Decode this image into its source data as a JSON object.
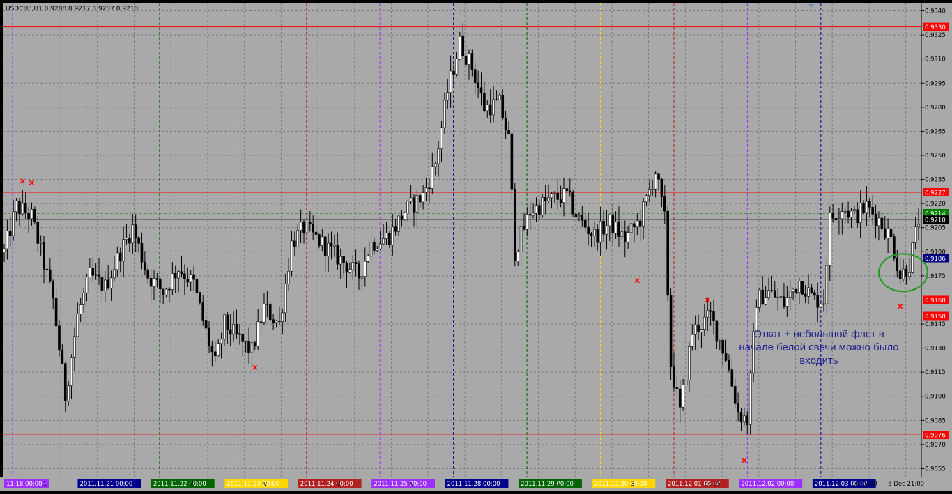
{
  "window_title": "USDCHF,H1  0.9208 0.9217 0.9207 0.9210",
  "annotation_text": "Откат + небольшой флет в начале белой свечи можно было входить",
  "colors": {
    "background": "#a9a9a9",
    "grid": "#7a7a7a",
    "candle": "#000000",
    "support_resistance": "#ff0000",
    "circle": "#1c9b1c",
    "current_price": "#000080"
  },
  "chart_data": {
    "type": "candlestick",
    "symbol": "USDCHF",
    "timeframe": "H1",
    "ylim": [
      0.905,
      0.9345
    ],
    "price_ticks": [
      "0.9340",
      "0.9325",
      "0.9310",
      "0.9295",
      "0.9280",
      "0.9265",
      "0.9250",
      "0.9235",
      "0.9220",
      "0.9205",
      "0.9190",
      "0.9175",
      "0.9160",
      "0.9145",
      "0.9130",
      "0.9115",
      "0.9100",
      "0.9085",
      "0.9070",
      "0.9055"
    ],
    "horizontal_levels": [
      {
        "price": 0.933,
        "label": "0.9330",
        "color": "#ff0000",
        "style": "solid",
        "label_bg": "#ff0000"
      },
      {
        "price": 0.9227,
        "label": "0.9227",
        "color": "#ff0000",
        "style": "solid",
        "label_bg": "#ff0000"
      },
      {
        "price": 0.9214,
        "label": "0.9214",
        "color": "#008000",
        "style": "dash",
        "label_bg": "#008000"
      },
      {
        "price": 0.921,
        "label": "0.9210",
        "color": "#555555",
        "style": "solid",
        "label_bg": "#000000"
      },
      {
        "price": 0.9186,
        "label": "0.9186",
        "color": "#0000aa",
        "style": "dash",
        "label_bg": "#000080"
      },
      {
        "price": 0.916,
        "label": "0.9160",
        "color": "#ff0000",
        "style": "dash",
        "label_bg": "#ff0000"
      },
      {
        "price": 0.915,
        "label": "0.9150",
        "color": "#ff0000",
        "style": "solid",
        "label_bg": "#ff0000"
      },
      {
        "price": 0.9076,
        "label": "0.9076",
        "color": "#ff0000",
        "style": "solid",
        "label_bg": "#ff0000"
      }
    ],
    "time_labels": [
      {
        "text": "11.18 00:00",
        "bg": "#9b30ff"
      },
      {
        "text": "1",
        "bg": ""
      },
      {
        "text": "2011.11.21 00:00",
        "bg": "#00008b"
      },
      {
        "text": "",
        "bg": ""
      },
      {
        "text": "2011.11.22 00:00",
        "bg": "#006400"
      },
      {
        "text": "2",
        "bg": ""
      },
      {
        "text": "2011.11.23 00:00",
        "bg": "#ffd700"
      },
      {
        "text": "v",
        "bg": ""
      },
      {
        "text": "2011.11.24 00:00",
        "bg": "#b22222"
      },
      {
        "text": "2",
        "bg": ""
      },
      {
        "text": "2011.11.25 00:00",
        "bg": "#9b30ff"
      },
      {
        "text": "v",
        "bg": ""
      },
      {
        "text": "2011.11.28 00:00",
        "bg": "#00008b"
      },
      {
        "text": "",
        "bg": ""
      },
      {
        "text": "2011.11.29 00:00",
        "bg": "#006400"
      },
      {
        "text": "v",
        "bg": ""
      },
      {
        "text": "2011.11.30 00:00",
        "bg": "#ffd700"
      },
      {
        "text": "3",
        "bg": ""
      },
      {
        "text": "2011.12.01 00:00",
        "bg": "#b22222"
      },
      {
        "text": "ec 05",
        "bg": ""
      },
      {
        "text": "2011.12.02 00:00",
        "bg": "#9b30ff"
      },
      {
        "text": "",
        "bg": ""
      },
      {
        "text": "2011.12.03 00:00",
        "bg": "#00008b"
      },
      {
        "text": "ec 05:00",
        "bg": ""
      },
      {
        "text": "5 Dec 21:00",
        "bg": ""
      }
    ],
    "vertical_separators": [
      {
        "color": "#9b30ff"
      },
      {
        "color": "#00008b"
      },
      {
        "color": "#006400"
      },
      {
        "color": "#ffd700"
      },
      {
        "color": "#b22222"
      },
      {
        "color": "#9b30ff"
      },
      {
        "color": "#00008b"
      },
      {
        "color": "#006400"
      },
      {
        "color": "#ffd700"
      },
      {
        "color": "#b22222"
      },
      {
        "color": "#9b30ff"
      },
      {
        "color": "#00008b"
      }
    ],
    "markers": [
      {
        "x_index": 6,
        "price": 0.9234
      },
      {
        "x_index": 9,
        "price": 0.9233
      },
      {
        "x_index": 82,
        "price": 0.9118
      },
      {
        "x_index": 207,
        "price": 0.9172
      },
      {
        "x_index": 230,
        "price": 0.916
      },
      {
        "x_index": 242,
        "price": 0.906
      },
      {
        "x_index": 293,
        "price": 0.9156
      }
    ],
    "path_keypoints": [
      [
        0,
        0.919
      ],
      [
        4,
        0.9218
      ],
      [
        9,
        0.9212
      ],
      [
        12,
        0.919
      ],
      [
        16,
        0.916
      ],
      [
        20,
        0.91
      ],
      [
        24,
        0.915
      ],
      [
        28,
        0.9175
      ],
      [
        33,
        0.9168
      ],
      [
        38,
        0.919
      ],
      [
        42,
        0.9205
      ],
      [
        47,
        0.9175
      ],
      [
        52,
        0.9165
      ],
      [
        57,
        0.918
      ],
      [
        62,
        0.917
      ],
      [
        66,
        0.914
      ],
      [
        69,
        0.912
      ],
      [
        72,
        0.9145
      ],
      [
        77,
        0.9135
      ],
      [
        81,
        0.9128
      ],
      [
        85,
        0.9155
      ],
      [
        90,
        0.9145
      ],
      [
        94,
        0.9195
      ],
      [
        98,
        0.9205
      ],
      [
        104,
        0.9195
      ],
      [
        110,
        0.9185
      ],
      [
        116,
        0.9175
      ],
      [
        120,
        0.9195
      ],
      [
        126,
        0.92
      ],
      [
        131,
        0.9215
      ],
      [
        137,
        0.9225
      ],
      [
        141,
        0.9245
      ],
      [
        145,
        0.929
      ],
      [
        149,
        0.932
      ],
      [
        153,
        0.9305
      ],
      [
        157,
        0.928
      ],
      [
        162,
        0.9282
      ],
      [
        165,
        0.926
      ],
      [
        167,
        0.919
      ],
      [
        172,
        0.9215
      ],
      [
        178,
        0.9222
      ],
      [
        184,
        0.9225
      ],
      [
        188,
        0.921
      ],
      [
        193,
        0.92
      ],
      [
        198,
        0.9208
      ],
      [
        203,
        0.9198
      ],
      [
        208,
        0.921
      ],
      [
        213,
        0.924
      ],
      [
        216,
        0.921
      ],
      [
        218,
        0.912
      ],
      [
        221,
        0.909
      ],
      [
        225,
        0.914
      ],
      [
        231,
        0.915
      ],
      [
        236,
        0.9125
      ],
      [
        240,
        0.909
      ],
      [
        243,
        0.9085
      ],
      [
        246,
        0.916
      ],
      [
        250,
        0.9165
      ],
      [
        255,
        0.9158
      ],
      [
        260,
        0.9172
      ],
      [
        265,
        0.916
      ],
      [
        268,
        0.916
      ],
      [
        270,
        0.921
      ],
      [
        274,
        0.9218
      ],
      [
        278,
        0.9212
      ],
      [
        282,
        0.9218
      ],
      [
        286,
        0.921
      ],
      [
        290,
        0.9198
      ],
      [
        293,
        0.9175
      ],
      [
        296,
        0.9182
      ],
      [
        299,
        0.921
      ]
    ],
    "candle_count": 300,
    "annotation_circle": {
      "x_index": 294,
      "price": 0.9177
    }
  }
}
